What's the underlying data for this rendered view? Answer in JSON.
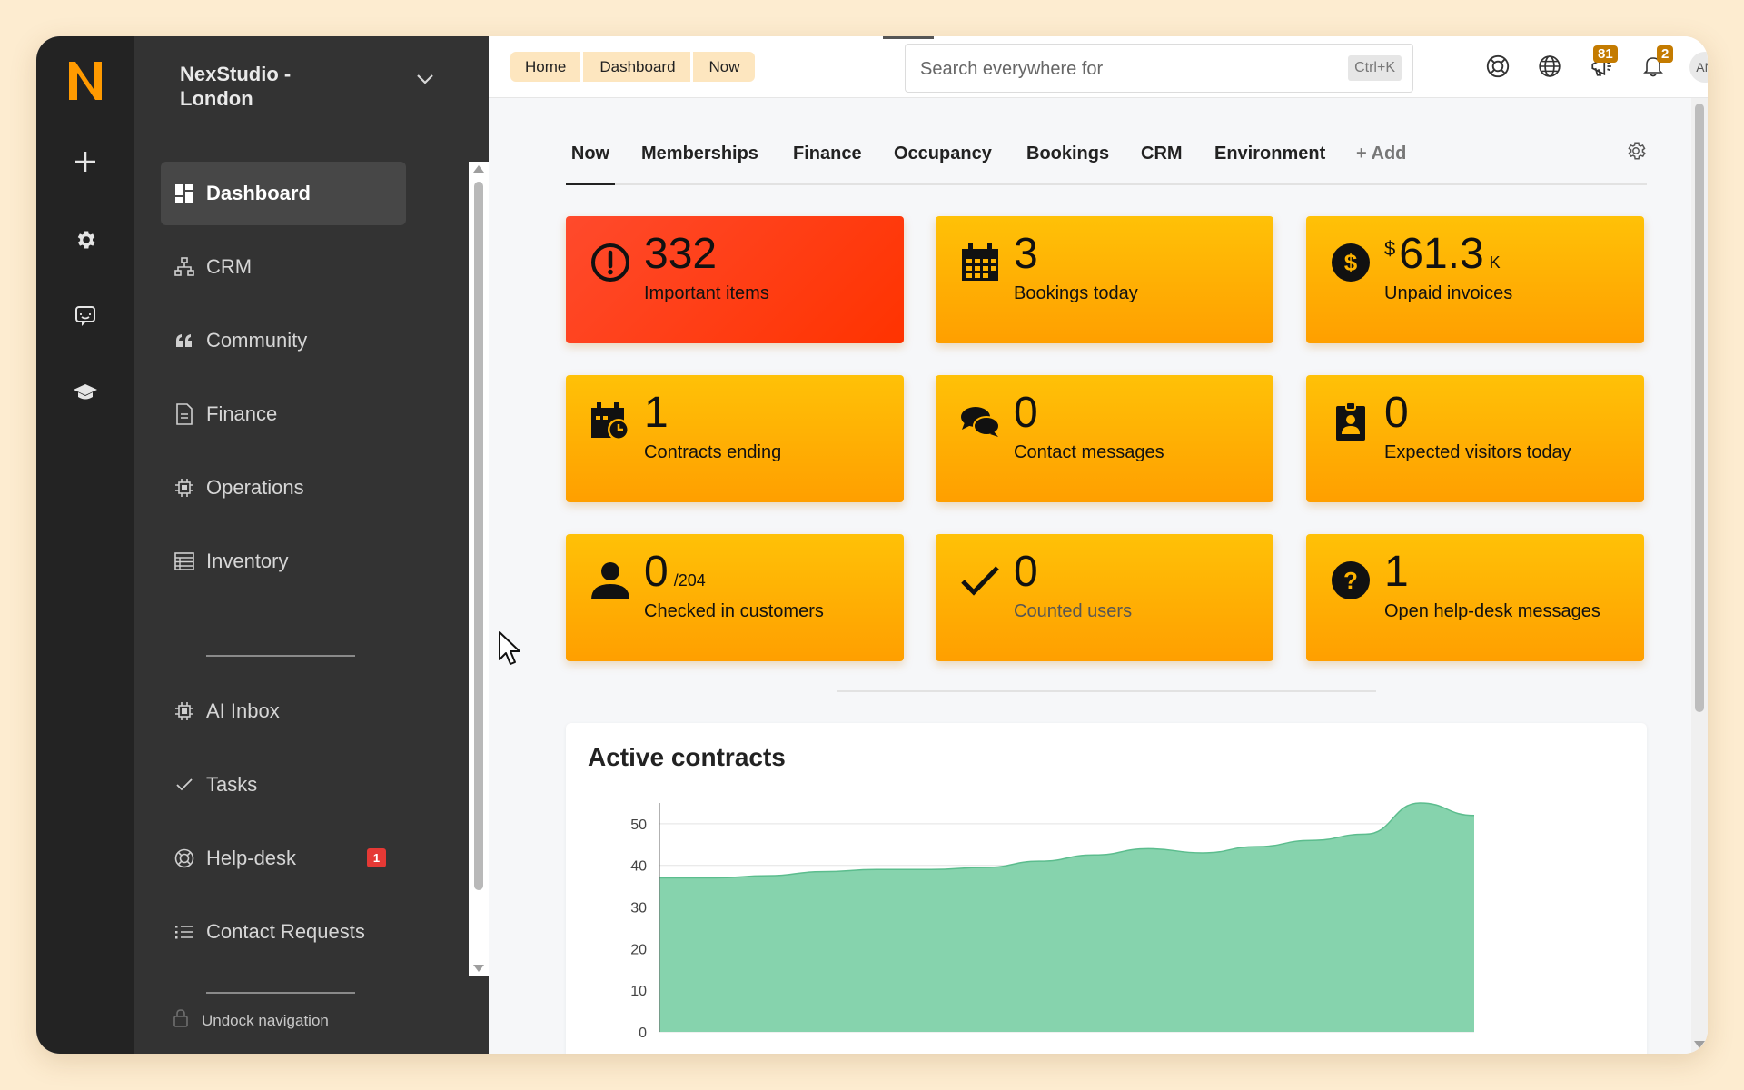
{
  "workspace": {
    "name": "NexStudio - London"
  },
  "rail": {
    "items": [
      "plus-icon",
      "gear-icon",
      "chat-icon",
      "graduation-cap-icon"
    ]
  },
  "sidebar": {
    "items": [
      {
        "label": "Dashboard",
        "icon": "dashboard-icon",
        "active": true
      },
      {
        "label": "CRM",
        "icon": "sitemap-icon"
      },
      {
        "label": "Community",
        "icon": "quote-icon"
      },
      {
        "label": "Finance",
        "icon": "document-icon"
      },
      {
        "label": "Operations",
        "icon": "chip-icon"
      },
      {
        "label": "Inventory",
        "icon": "table-icon"
      },
      {
        "label": "AI Inbox",
        "icon": "chip-icon"
      },
      {
        "label": "Tasks",
        "icon": "check-icon"
      },
      {
        "label": "Help-desk",
        "icon": "lifebuoy-icon",
        "badge": "1"
      },
      {
        "label": "Contact Requests",
        "icon": "list-icon"
      }
    ],
    "undock_label": "Undock navigation"
  },
  "breadcrumb": [
    "Home",
    "Dashboard",
    "Now"
  ],
  "search": {
    "placeholder": "Search everywhere for",
    "shortcut": "Ctrl+K"
  },
  "topbar": {
    "megaphone_badge": "81",
    "bell_badge": "2",
    "avatar_initials": "AN"
  },
  "tabs": [
    "Now",
    "Memberships",
    "Finance",
    "Occupancy",
    "Bookings",
    "CRM",
    "Environment",
    "+ Add"
  ],
  "cards": [
    {
      "value": "332",
      "label": "Important items",
      "icon": "alert-circle-icon"
    },
    {
      "value": "3",
      "label": "Bookings today",
      "icon": "calendar-icon"
    },
    {
      "prefix": "$",
      "value": "61.3",
      "suffix": "K",
      "label": "Unpaid invoices",
      "icon": "dollar-coin-icon"
    },
    {
      "value": "1",
      "label": "Contracts ending",
      "icon": "calendar-clock-icon"
    },
    {
      "value": "0",
      "label": "Contact messages",
      "icon": "chat-bubbles-icon"
    },
    {
      "value": "0",
      "label": "Expected visitors today",
      "icon": "badge-person-icon"
    },
    {
      "value": "0",
      "suffix": "/204",
      "label": "Checked in customers",
      "icon": "person-icon"
    },
    {
      "value": "0",
      "label": "Counted users",
      "icon": "checkmark-icon"
    },
    {
      "value": "1",
      "label": "Open help-desk messages",
      "icon": "question-circle-icon"
    }
  ],
  "colors": {
    "accent": "#ff9800",
    "card_red": "#ff3d1f",
    "card_yellow": "#ffb300",
    "chart_fill": "#86d3ad",
    "chart_line": "#5cbd8e"
  },
  "panel": {
    "title": "Active contracts"
  },
  "chart_data": {
    "type": "area",
    "title": "Active contracts",
    "xlabel": "",
    "ylabel": "",
    "y": [
      37,
      37,
      37.5,
      38.5,
      39,
      39,
      39.5,
      41,
      42.5,
      44,
      43,
      44.5,
      46,
      47.5,
      55,
      52
    ],
    "ylim": [
      0,
      55
    ],
    "yticks": [
      0,
      10,
      20,
      30,
      40,
      50
    ],
    "grid": true
  }
}
